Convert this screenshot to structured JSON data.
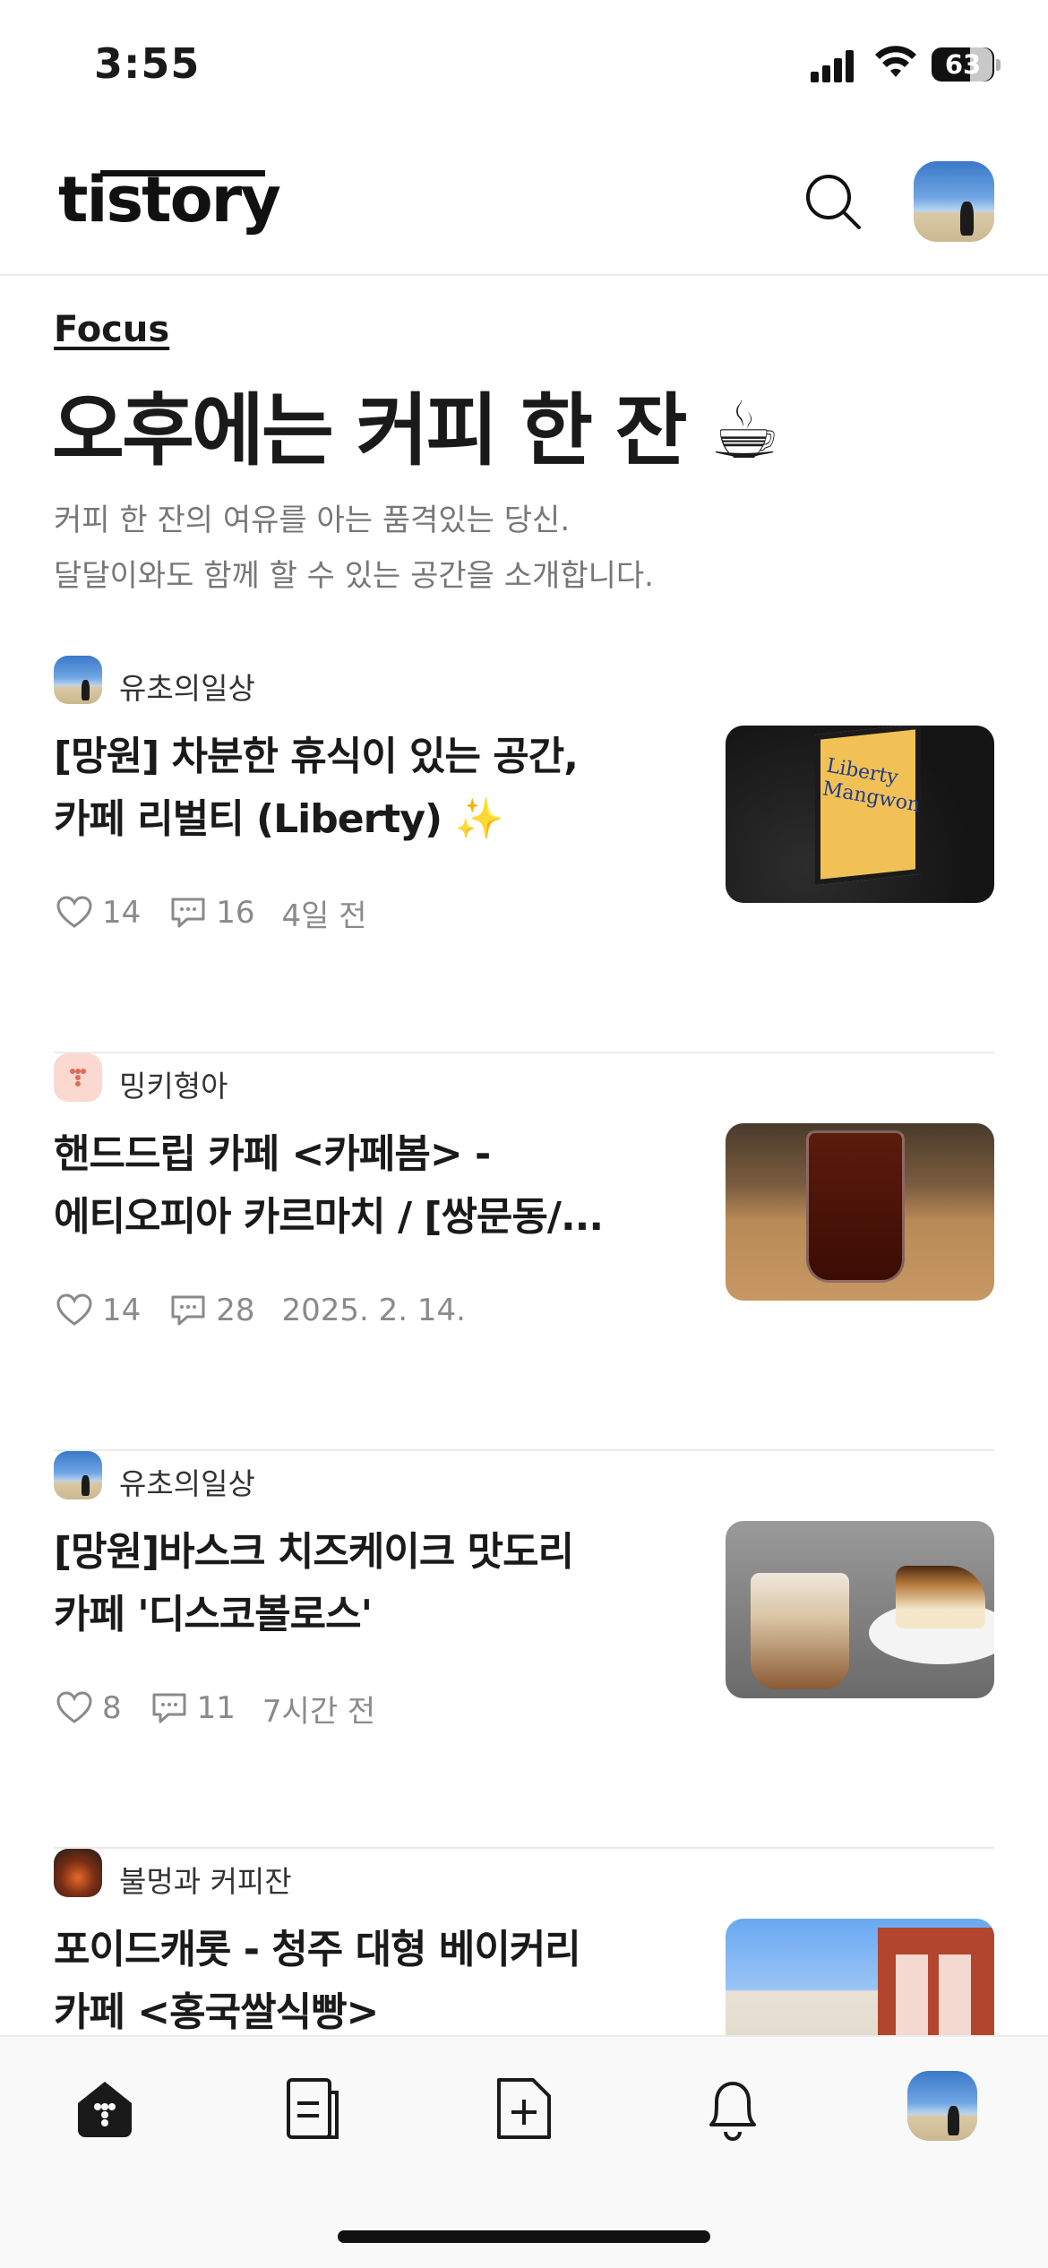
{
  "status_bar": {
    "time": "3:55",
    "battery": "63"
  },
  "header": {
    "logo": "tistory",
    "search_icon": "search-icon",
    "avatar_icon": "profile-avatar"
  },
  "focus": {
    "label": "Focus",
    "title": "오후에는 커피 한 잔 ☕",
    "description_line1": "커피 한 잔의 여유를 아는 품격있는 당신.",
    "description_line2": "달달이와도 함께 할 수 있는 공간을 소개합니다."
  },
  "posts": [
    {
      "author": "유초의일상",
      "title_line1": "[망원] 차분한 휴식이 있는 공간,",
      "title_line2": "카페 리벌티 (Liberty) ✨",
      "likes": "14",
      "comments": "16",
      "time": "4일 전",
      "thumb_text": "Liberty Mangwon"
    },
    {
      "author": "밍키형아",
      "title_line1": "핸드드립 카페 <카페봄> -",
      "title_line2": "에티오피아 카르마치 / [쌍문동/...",
      "likes": "14",
      "comments": "28",
      "time": "2025. 2. 14."
    },
    {
      "author": "유초의일상",
      "title_line1": "[망원]바스크 치즈케이크 맛도리",
      "title_line2": "카페 '디스코볼로스'",
      "likes": "8",
      "comments": "11",
      "time": "7시간 전"
    },
    {
      "author": "불멍과 커피잔",
      "title_line1": "포이드캐롯 - 청주 대형 베이커리",
      "title_line2": "카페 <홍국쌀식빵>",
      "likes": "",
      "comments": "",
      "time": ""
    }
  ],
  "tab_bar": {
    "tabs": [
      "home-icon",
      "feed-icon",
      "write-icon",
      "notification-icon",
      "profile-avatar"
    ]
  },
  "colors": {
    "text_primary": "#1a1a1a",
    "text_secondary": "#777777",
    "meta_gray": "#8a8a8a",
    "divider": "#ebebeb",
    "tab_bar_bg": "#f9f9f9"
  }
}
